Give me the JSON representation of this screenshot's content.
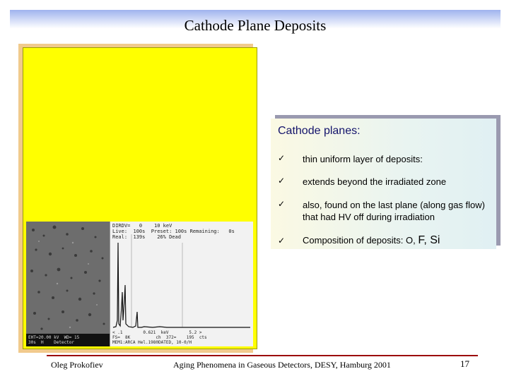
{
  "slide": {
    "title": "Cathode Plane Deposits",
    "colors": {
      "title_gradient_top": "#9fb3ee",
      "image_panel": "#ffff00",
      "heading": "#13136b",
      "footer_rule": "#9b0a0a"
    }
  },
  "sem_image": {
    "info_text": "EHT=20.00 kV  WD= 15\n30s  H    Detector"
  },
  "spectrum": {
    "header_text": "DIRDV=   0    10 keV\nLive:  100s  Preset: 100s Remaining:   0s\nReal:  139s    26% Dead",
    "footer_text": "< .1        0.621  keV        5.2 >\nFS=  8K          ch  372=    195  cts\nMEM1:ARCA Hel.1980DATED, 10-0/H"
  },
  "info": {
    "heading": "Cathode planes:",
    "bullet_glyph": "✓",
    "items": [
      {
        "text": "thin uniform layer of deposits:"
      },
      {
        "text": "extends beyond the irradiated zone"
      },
      {
        "text": "also, found on the last plane (along gas flow) that had HV off during irradiation"
      },
      {
        "text_prefix": "Composition of deposits: O,",
        "text_big": "F, Si"
      }
    ]
  },
  "footer": {
    "author": "Oleg Prokofiev",
    "center": "Aging Phenomena in Gaseous Detectors,  DESY, Hamburg 2001",
    "page": "17"
  }
}
